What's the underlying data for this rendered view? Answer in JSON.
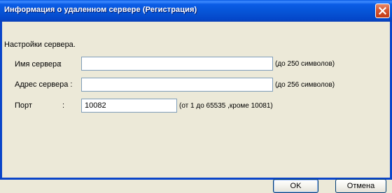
{
  "window": {
    "title": "Информация о удаленном сервере (Регистрация)",
    "close_icon": "close-icon"
  },
  "section": {
    "title": "Настройки сервера."
  },
  "fields": {
    "server_name": {
      "label": "Имя сервера",
      "colon": ":",
      "value": "",
      "hint": "(до 250 символов)"
    },
    "server_address": {
      "label": "Адрес сервера :",
      "value": "",
      "hint": "(до 256 символов)"
    },
    "port": {
      "label": "Порт",
      "colon": ":",
      "value": "10082",
      "hint": "(от 1 до 65535 ,кроме 10081)"
    }
  },
  "buttons": {
    "ok_label": "OK",
    "cancel_label": "Отмена"
  },
  "colors": {
    "titlebar": "#0654d6",
    "window_border": "#0a45c9",
    "close_button": "#d85a35",
    "background": "#ece9d8",
    "field_border": "#7f9db9"
  }
}
